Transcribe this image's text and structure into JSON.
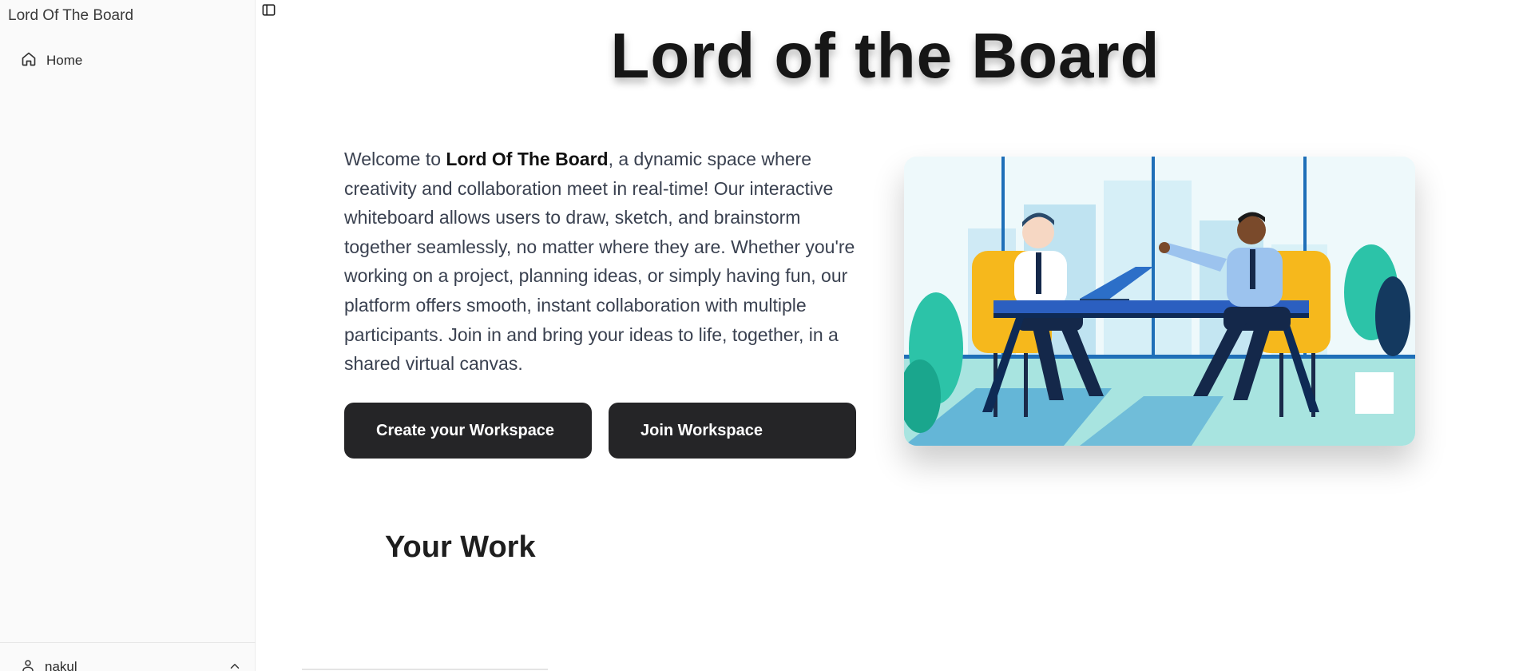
{
  "sidebar": {
    "app_title": "Lord Of The Board",
    "items": [
      {
        "label": "Home",
        "icon": "home-icon"
      }
    ],
    "user": {
      "name": "nakul",
      "icon": "user-icon",
      "toggle_icon": "chevron-up-icon"
    }
  },
  "toolbar": {
    "sidebar_toggle_icon": "panel-left-icon"
  },
  "main": {
    "title": "Lord of the Board",
    "intro": {
      "prefix": "Welcome to ",
      "brand": "Lord Of The Board",
      "body": ", a dynamic space where creativity and collaboration meet in real-time! Our interactive whiteboard allows users to draw, sketch, and brainstorm together seamlessly, no matter where they are. Whether you're working on a project, planning ideas, or simply having fun, our platform offers smooth, instant collaboration with multiple participants. Join in and bring your ideas to life, together, in a shared virtual canvas."
    },
    "buttons": {
      "create_label": "Create your Workspace",
      "join_label": "Join Workspace"
    },
    "section_title": "Your Work"
  },
  "colors": {
    "button_bg": "#252527",
    "sidebar_bg": "#fafafa",
    "accent_blue": "#1f6fb8",
    "accent_yellow": "#f6b81c",
    "accent_teal": "#2cc3a8"
  }
}
